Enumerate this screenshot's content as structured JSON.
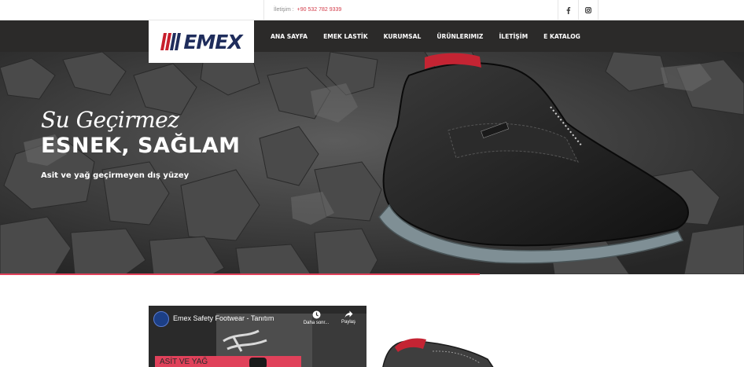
{
  "topbar": {
    "contact_label": "İletişim :",
    "phone": "+90 532 782 9339",
    "social": [
      {
        "icon": "facebook-icon"
      },
      {
        "icon": "instagram-icon"
      }
    ]
  },
  "logo": {
    "text": "EMEX",
    "stripe_colors": [
      "#c81e2c",
      "#1f2d5c"
    ]
  },
  "nav": {
    "items": [
      {
        "label": "ANA SAYFA"
      },
      {
        "label": "EMEK LASTİK"
      },
      {
        "label": "KURUMSAL"
      },
      {
        "label": "ÜRÜNLERIMIZ"
      },
      {
        "label": "İLETİŞİM"
      },
      {
        "label": "E KATALOG"
      }
    ]
  },
  "hero": {
    "script_text": "Su Geçirmez",
    "headline": "ESNEK, SAĞLAM",
    "subline": "Asit ve yağ geçirmeyen dış yüzey",
    "accent_color": "#e0415a"
  },
  "video": {
    "title": "Emex Safety Footwear - Tanıtım",
    "watch_later": "Daha sonr...",
    "share": "Paylaş",
    "caption": "ASİT VE YAĞ"
  },
  "colors": {
    "nav_bg": "#2b2a29",
    "brand_navy": "#1f2d5c",
    "brand_red": "#c81e2c",
    "phone_red": "#d23a48"
  }
}
